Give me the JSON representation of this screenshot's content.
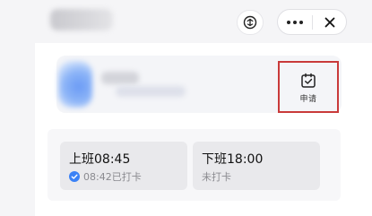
{
  "header": {
    "title_blurred": true,
    "mini_app_icon": "mini-program-icon",
    "more_icon": "more-dots-icon",
    "close_icon": "close-icon",
    "close_label": "×"
  },
  "profile": {
    "avatar_blurred": true,
    "name_blurred": true,
    "department_blurred": true
  },
  "apply": {
    "icon": "calendar-check-icon",
    "label": "申请",
    "highlight_color": "#c93a3a"
  },
  "punch": {
    "clock_in": {
      "title": "上班08:45",
      "status": "08:42已打卡",
      "status_icon": "check-circle-icon",
      "status_icon_color": "#3b82f6"
    },
    "clock_out": {
      "title": "下班18:00",
      "status": "未打卡"
    }
  }
}
